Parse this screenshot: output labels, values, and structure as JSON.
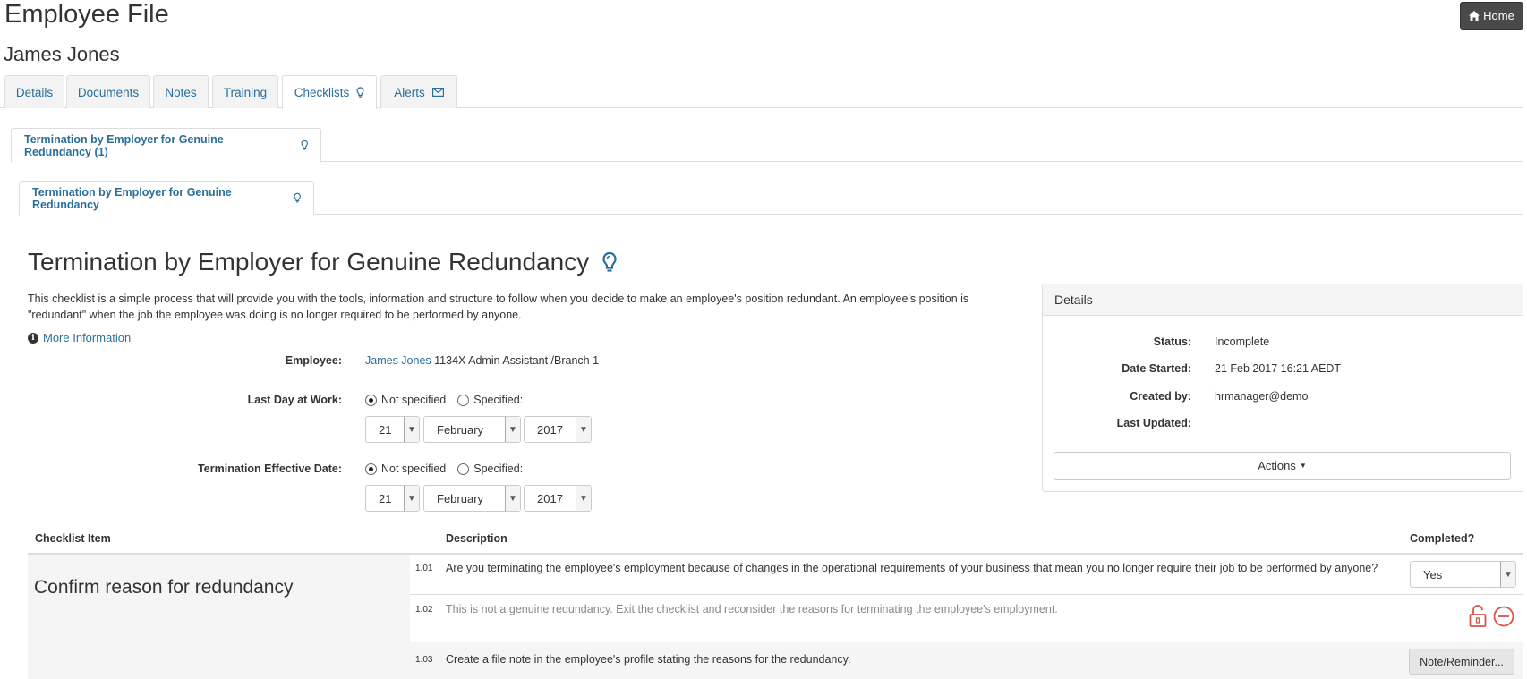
{
  "header": {
    "title": "Employee File",
    "home_label": "Home",
    "employee_name": "James Jones"
  },
  "tabs": [
    {
      "label": "Details"
    },
    {
      "label": "Documents"
    },
    {
      "label": "Notes"
    },
    {
      "label": "Training"
    },
    {
      "label": "Checklists"
    },
    {
      "label": "Alerts"
    }
  ],
  "subtab1": {
    "label": "Termination by Employer for Genuine Redundancy (1)"
  },
  "subtab2": {
    "label": "Termination by Employer for Genuine Redundancy"
  },
  "checklist": {
    "title": "Termination by Employer for Genuine Redundancy",
    "description": "This checklist is a simple process that will provide you with the tools, information and structure to follow when you decide to make an employee's position redundant. An employee's position is \"redundant\" when the job the employee was doing is no longer required to be performed by anyone.",
    "more_info": "More Information"
  },
  "form": {
    "employee_label": "Employee:",
    "employee_link": "James Jones",
    "employee_rest": "1134X Admin Assistant /Branch 1",
    "last_day_label": "Last Day at Work:",
    "termination_label": "Termination Effective Date:",
    "not_specified": "Not specified",
    "specified": "Specified:",
    "last_day": {
      "day": "21",
      "month": "February",
      "year": "2017"
    },
    "termination": {
      "day": "21",
      "month": "February",
      "year": "2017"
    }
  },
  "details": {
    "header": "Details",
    "status_label": "Status:",
    "status": "Incomplete",
    "started_label": "Date Started:",
    "started": "21 Feb 2017 16:21 AEDT",
    "created_label": "Created by:",
    "created": "hrmanager@demo",
    "updated_label": "Last Updated:",
    "updated": "",
    "actions_label": "Actions"
  },
  "table": {
    "col_item": "Checklist Item",
    "col_desc": "Description",
    "col_completed": "Completed?",
    "group": "Confirm reason for redundancy",
    "rows": [
      {
        "num": "1.01",
        "text": "Are you terminating the employee's employment because of changes in the operational requirements of your business that mean you no longer require their job to be performed by anyone?",
        "completed": "Yes"
      },
      {
        "num": "1.02",
        "text": "This is not a genuine redundancy. Exit the checklist and reconsider the reasons for terminating the employee's employment."
      },
      {
        "num": "1.03",
        "text": "Create a file note in the employee's profile stating the reasons for the redundancy.",
        "button": "Note/Reminder..."
      }
    ]
  },
  "colors": {
    "link": "#2a6f9b",
    "alert_icon": "#d9534f",
    "home_bg": "#4a4a4a"
  }
}
